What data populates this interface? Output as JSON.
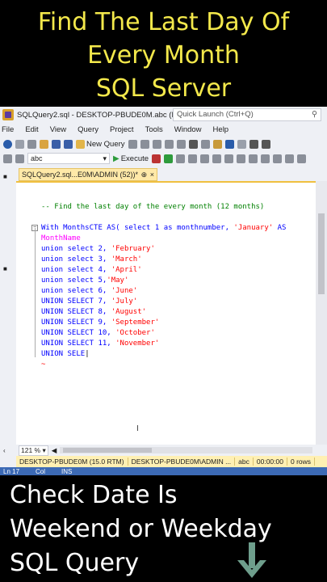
{
  "banner": {
    "line1": "Find The Last Day Of",
    "line2": "Every Month",
    "line3": "SQL Server"
  },
  "titlebar": {
    "title": "SQLQuery2.sql - DESKTOP-PBUDE0M.abc (DE...",
    "quick_launch_placeholder": "Quick Launch (Ctrl+Q)"
  },
  "menu": [
    "File",
    "Edit",
    "View",
    "Query",
    "Project",
    "Tools",
    "Window",
    "Help"
  ],
  "toolbar": {
    "new_query_label": "New Query",
    "database_value": "abc",
    "execute_label": "Execute"
  },
  "tab": {
    "label": "SQLQuery2.sql...E0M\\ADMIN (52))*",
    "pin": "⊕",
    "close": "×"
  },
  "code_lines": {
    "comment": "-- Find the last day of the every month (12 months)",
    "with_line_a": "With MonthsCTE AS( select 1 as monthnumber, ",
    "with_line_b": "'January'",
    "with_line_c": " AS",
    "with_line_d": "MonthName",
    "u2a": "union select 2, ",
    "u2b": "'February'",
    "u3a": "union select 3, ",
    "u3b": "'March'",
    "u4a": "union select 4, ",
    "u4b": "'April'",
    "u5a": "union select 5,",
    "u5b": "'May'",
    "u6a": "union select 6, ",
    "u6b": "'June'",
    "u7a": "UNION SELECT 7, ",
    "u7b": "'July'",
    "u8a": "UNION SELECT 8, ",
    "u8b": "'August'",
    "u9a": "UNION SELECT 9, ",
    "u9b": "'September'",
    "u10a": "UNION SELECT 10, ",
    "u10b": "'October'",
    "u11a": "UNION SELECT 11, ",
    "u11b": "'November'",
    "u12": "UNION SELE"
  },
  "zoom": {
    "value": "121 %"
  },
  "status": {
    "server": "DESKTOP-PBUDE0M (15.0 RTM)",
    "user": "DESKTOP-PBUDE0M\\ADMIN ...",
    "db": "abc",
    "time": "00:00:00",
    "rows": "0 rows"
  },
  "bottom": {
    "ln": "Ln 17",
    "col": "Col",
    "ins": "INS"
  },
  "footer": {
    "line1": "Check Date Is",
    "line2": "Weekend or Weekday",
    "line3": "SQL Query"
  },
  "colors": {
    "banner_text": "#f3e84b",
    "keyword": "#0000ff",
    "string": "#ff0000",
    "comment": "#008000",
    "arrow": "#6e9e8c"
  }
}
